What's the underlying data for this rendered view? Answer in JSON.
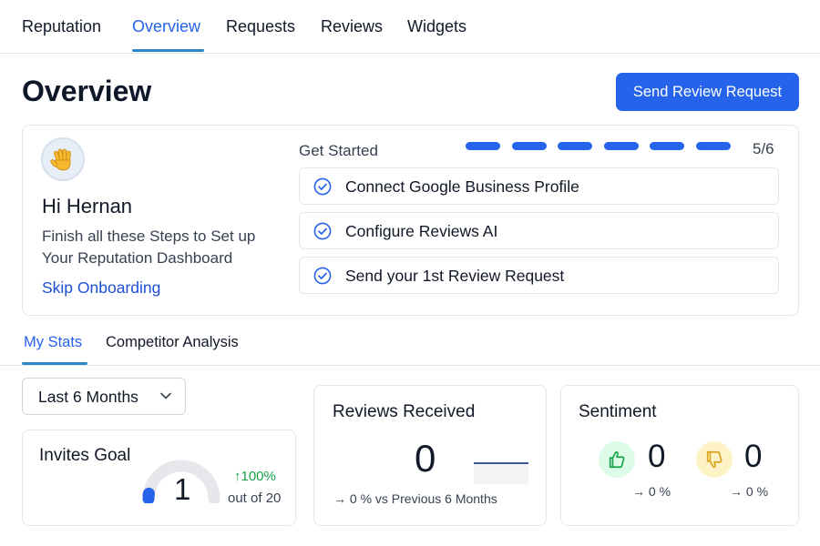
{
  "nav": {
    "tabs": [
      "Reputation",
      "Overview",
      "Requests",
      "Reviews",
      "Widgets"
    ],
    "active": "Overview"
  },
  "page": {
    "title": "Overview",
    "primary_action": "Send Review Request"
  },
  "onboarding": {
    "avatar_icon": "waving-hand-icon",
    "greeting": "Hi Hernan",
    "instructions": "Finish all these Steps to Set up Your Reputation Dashboard",
    "skip_label": "Skip Onboarding",
    "get_started_label": "Get Started",
    "progress_text": "5/6",
    "progress_segments_filled": 6,
    "steps": [
      {
        "label": "Connect Google Business Profile",
        "done": true
      },
      {
        "label": "Configure Reviews AI",
        "done": true
      },
      {
        "label": "Send your 1st Review Request",
        "done": true
      }
    ]
  },
  "stats_tabs": {
    "tabs": [
      "My Stats",
      "Competitor Analysis"
    ],
    "active": "My Stats"
  },
  "range_select": {
    "value": "Last 6 Months"
  },
  "invites_goal": {
    "title": "Invites Goal",
    "value": "1",
    "change": "↑100%",
    "out_of": "out of 20",
    "progress_fraction": 0.05
  },
  "reviews_received": {
    "title": "Reviews Received",
    "value": "0",
    "comparison": "→ 0 % vs Previous 6 Months"
  },
  "sentiment": {
    "title": "Sentiment",
    "positive_value": "0",
    "positive_change": "→ 0 %",
    "negative_value": "0",
    "negative_change": "→ 0 %"
  },
  "colors": {
    "accent": "#2563eb",
    "tab_underline": "#2b88c8",
    "positive": "#16a34a",
    "positive_bg": "#dcfce7",
    "negative_bg": "#fef3c7"
  }
}
